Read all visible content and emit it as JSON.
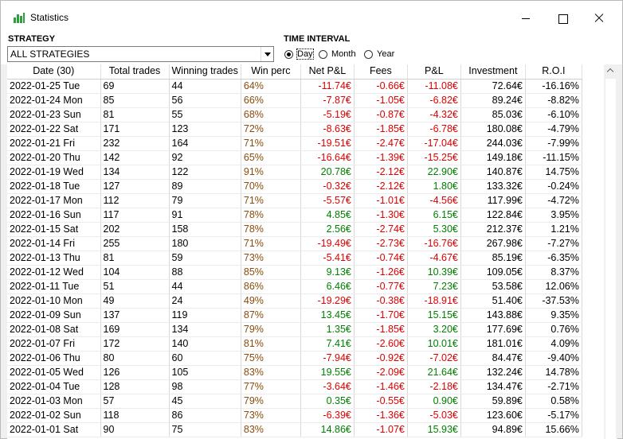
{
  "window": {
    "title": "Statistics"
  },
  "filters": {
    "strategy_label": "STRATEGY",
    "strategy_value": "ALL STRATEGIES",
    "interval_label": "TIME INTERVAL",
    "options": [
      "Day",
      "Month",
      "Year"
    ],
    "selected": "Day"
  },
  "table": {
    "columns": [
      "Date (30)",
      "Total trades",
      "Winning trades",
      "Win perc",
      "Net P&L",
      "Fees",
      "P&L",
      "Investment",
      "R.O.I"
    ],
    "rows": [
      [
        "2022-01-25 Tue",
        "69",
        "44",
        "64%",
        "-11.74€",
        "-0.66€",
        "-11.08€",
        "72.64€",
        "-16.16%"
      ],
      [
        "2022-01-24 Mon",
        "85",
        "56",
        "66%",
        "-7.87€",
        "-1.05€",
        "-6.82€",
        "89.24€",
        "-8.82%"
      ],
      [
        "2022-01-23 Sun",
        "81",
        "55",
        "68%",
        "-5.19€",
        "-0.87€",
        "-4.32€",
        "85.03€",
        "-6.10%"
      ],
      [
        "2022-01-22 Sat",
        "171",
        "123",
        "72%",
        "-8.63€",
        "-1.85€",
        "-6.78€",
        "180.08€",
        "-4.79%"
      ],
      [
        "2022-01-21 Fri",
        "232",
        "164",
        "71%",
        "-19.51€",
        "-2.47€",
        "-17.04€",
        "244.03€",
        "-7.99%"
      ],
      [
        "2022-01-20 Thu",
        "142",
        "92",
        "65%",
        "-16.64€",
        "-1.39€",
        "-15.25€",
        "149.18€",
        "-11.15%"
      ],
      [
        "2022-01-19 Wed",
        "134",
        "122",
        "91%",
        "20.78€",
        "-2.12€",
        "22.90€",
        "140.87€",
        "14.75%"
      ],
      [
        "2022-01-18 Tue",
        "127",
        "89",
        "70%",
        "-0.32€",
        "-2.12€",
        "1.80€",
        "133.32€",
        "-0.24%"
      ],
      [
        "2022-01-17 Mon",
        "112",
        "79",
        "71%",
        "-5.57€",
        "-1.01€",
        "-4.56€",
        "117.99€",
        "-4.72%"
      ],
      [
        "2022-01-16 Sun",
        "117",
        "91",
        "78%",
        "4.85€",
        "-1.30€",
        "6.15€",
        "122.84€",
        "3.95%"
      ],
      [
        "2022-01-15 Sat",
        "202",
        "158",
        "78%",
        "2.56€",
        "-2.74€",
        "5.30€",
        "212.37€",
        "1.21%"
      ],
      [
        "2022-01-14 Fri",
        "255",
        "180",
        "71%",
        "-19.49€",
        "-2.73€",
        "-16.76€",
        "267.98€",
        "-7.27%"
      ],
      [
        "2022-01-13 Thu",
        "81",
        "59",
        "73%",
        "-5.41€",
        "-0.74€",
        "-4.67€",
        "85.19€",
        "-6.35%"
      ],
      [
        "2022-01-12 Wed",
        "104",
        "88",
        "85%",
        "9.13€",
        "-1.26€",
        "10.39€",
        "109.05€",
        "8.37%"
      ],
      [
        "2022-01-11 Tue",
        "51",
        "44",
        "86%",
        "6.46€",
        "-0.77€",
        "7.23€",
        "53.58€",
        "12.06%"
      ],
      [
        "2022-01-10 Mon",
        "49",
        "24",
        "49%",
        "-19.29€",
        "-0.38€",
        "-18.91€",
        "51.40€",
        "-37.53%"
      ],
      [
        "2022-01-09 Sun",
        "137",
        "119",
        "87%",
        "13.45€",
        "-1.70€",
        "15.15€",
        "143.88€",
        "9.35%"
      ],
      [
        "2022-01-08 Sat",
        "169",
        "134",
        "79%",
        "1.35€",
        "-1.85€",
        "3.20€",
        "177.69€",
        "0.76%"
      ],
      [
        "2022-01-07 Fri",
        "172",
        "140",
        "81%",
        "7.41€",
        "-2.60€",
        "10.01€",
        "181.01€",
        "4.09%"
      ],
      [
        "2022-01-06 Thu",
        "80",
        "60",
        "75%",
        "-7.94€",
        "-0.92€",
        "-7.02€",
        "84.47€",
        "-9.40%"
      ],
      [
        "2022-01-05 Wed",
        "126",
        "105",
        "83%",
        "19.55€",
        "-2.09€",
        "21.64€",
        "132.24€",
        "14.78%"
      ],
      [
        "2022-01-04 Tue",
        "128",
        "98",
        "77%",
        "-3.64€",
        "-1.46€",
        "-2.18€",
        "134.47€",
        "-2.71%"
      ],
      [
        "2022-01-03 Mon",
        "57",
        "45",
        "79%",
        "0.35€",
        "-0.55€",
        "0.90€",
        "59.89€",
        "0.58%"
      ],
      [
        "2022-01-02 Sun",
        "118",
        "86",
        "73%",
        "-6.39€",
        "-1.36€",
        "-5.03€",
        "123.60€",
        "-5.17%"
      ],
      [
        "2022-01-01 Sat",
        "90",
        "75",
        "83%",
        "14.86€",
        "-1.07€",
        "15.93€",
        "94.89€",
        "15.66%"
      ]
    ]
  },
  "colors": {
    "negative": "#e00000",
    "positive": "#008000",
    "win_perc": "#8a4a0c",
    "title_icon": "#2e9e3e"
  },
  "icons": {
    "title": "bar-chart-icon",
    "minimize": "minimize-icon",
    "maximize": "maximize-icon",
    "close": "close-icon",
    "dropdown": "chevron-down-icon",
    "scroll_up": "chevron-up-icon"
  }
}
